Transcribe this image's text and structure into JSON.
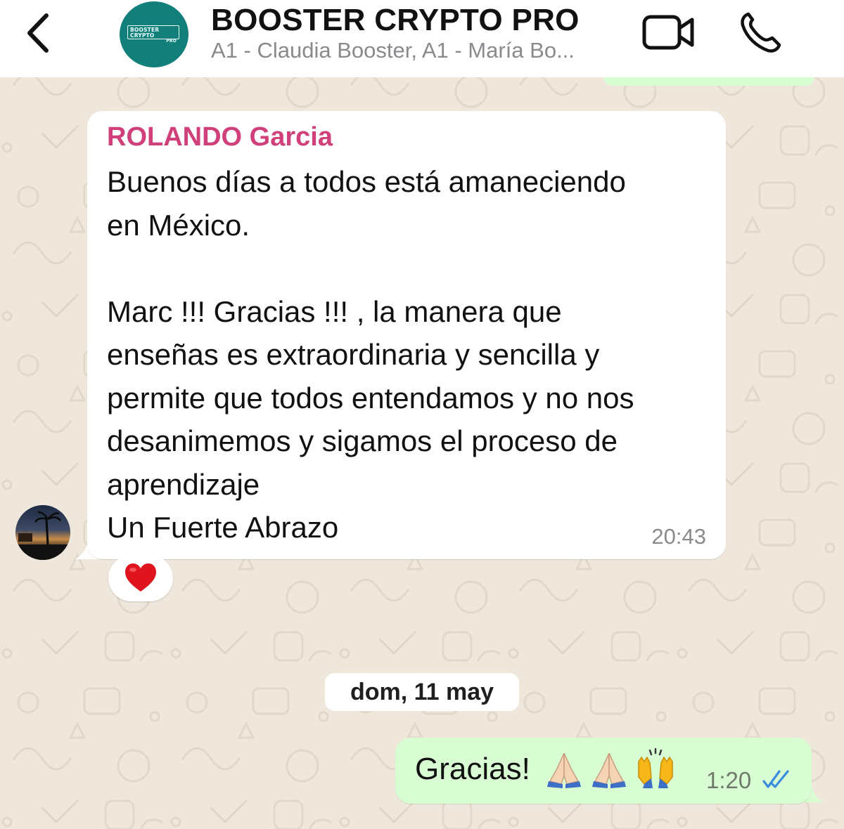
{
  "header": {
    "title": "BOOSTER CRYPTO PRO",
    "subtitle": "A1 - Claudia Booster, A1 - María Bo...",
    "avatar_logo_line1": "BOOSTER CRYPTO",
    "avatar_logo_line2": "PRO",
    "back_icon": "chevron-left-icon",
    "video_icon": "video-camera-icon",
    "call_icon": "phone-icon"
  },
  "messages": [
    {
      "direction": "incoming",
      "sender": "ROLANDO Garcia",
      "text": "Buenos días a todos está amaneciendo\nen México.\n\nMarc !!! Gracias !!! , la manera que\nenseñas es extraordinaria y sencilla y\npermite que todos entendamos y no nos\ndesanimemos y sigamos el proceso de\naprendizaje\nUn Fuerte Abrazo",
      "time": "20:43",
      "reaction": "red-heart"
    },
    {
      "direction": "outgoing",
      "text": "Gracias!",
      "emojis": [
        "folded-hands",
        "folded-hands",
        "raising-hands"
      ],
      "time": "1:20",
      "status": "read"
    }
  ],
  "date_separator": "dom, 11 may",
  "colors": {
    "sender_name": "#d0407a",
    "avatar_bg": "#127f7a",
    "outgoing_bubble": "#d9fdd3",
    "read_ticks": "#3a8dde",
    "wallpaper": "#efe7dc"
  }
}
